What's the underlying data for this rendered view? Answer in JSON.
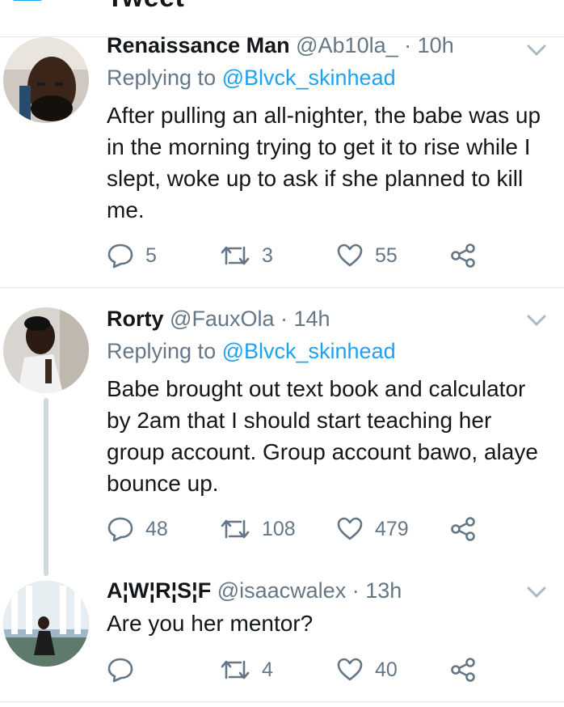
{
  "header": {
    "title": "Tweet",
    "back_icon": "back-arrow-icon"
  },
  "colors": {
    "accent": "#1da1f2",
    "secondary_text": "#657786",
    "divider": "#e1e8ed"
  },
  "tweets": [
    {
      "name": "Renaissance Man",
      "handle": "@Ab10la_",
      "separator": "·",
      "time": "10h",
      "reply_prefix": "Replying to ",
      "reply_to": "@Blvck_skinhead",
      "body": "After pulling an all-nighter, the babe was up in the morning trying to get it to rise while I slept, woke up to ask if she planned to kill me.",
      "replies": "5",
      "retweets": "3",
      "likes": "55"
    },
    {
      "name": "Rorty",
      "handle": "@FauxOla",
      "separator": "·",
      "time": "14h",
      "reply_prefix": "Replying to ",
      "reply_to": "@Blvck_skinhead",
      "body": "Babe brought out text book and calculator by 2am that I should start teaching her group account. Group account bawo, alaye bounce up.",
      "replies": "48",
      "retweets": "108",
      "likes": "479"
    },
    {
      "name": "A¦W¦R¦S¦F",
      "handle": "@isaacwalex",
      "separator": "·",
      "time": "13h",
      "body": "Are you her mentor?",
      "replies": "",
      "retweets": "4",
      "likes": "40"
    }
  ]
}
